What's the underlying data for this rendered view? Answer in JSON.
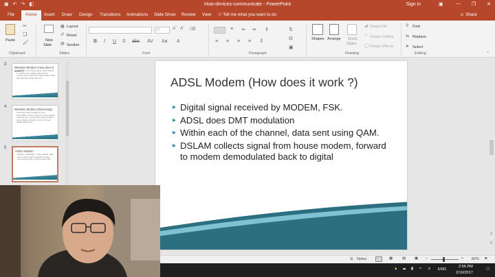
{
  "window": {
    "title": "How-devices-communicate - PowerPoint",
    "sign_in": "Sign in",
    "quick_access": [
      "save-icon",
      "undo-icon",
      "redo-icon",
      "present-icon"
    ]
  },
  "tabs": [
    "File",
    "Home",
    "Insert",
    "Draw",
    "Design",
    "Transitions",
    "Animations",
    "Slide Show",
    "Review",
    "View"
  ],
  "active_tab": "Home",
  "tell_me": "Tell me what you want to do",
  "share_label": "Share",
  "ribbon": {
    "clipboard": {
      "paste": "Paste",
      "label": "Clipboard"
    },
    "slides": {
      "new_slide_1": "New",
      "new_slide_2": "Slide",
      "layout": "Layout",
      "reset": "Reset",
      "section": "Section",
      "label": "Slides"
    },
    "font": {
      "size": "27",
      "label": "Font"
    },
    "paragraph": {
      "label": "Paragraph"
    },
    "drawing": {
      "shapes": "Shapes",
      "arrange": "Arrange",
      "quick_styles_1": "Quick",
      "quick_styles_2": "Styles",
      "shape_fill": "Shape Fill",
      "shape_outline": "Shape Outline",
      "shape_effects": "Shape Effects",
      "label": "Drawing"
    },
    "editing": {
      "find": "Find",
      "replace": "Replace",
      "select": "Select",
      "label": "Editing"
    }
  },
  "thumbnails": [
    {
      "num": "3",
      "title": "Wireless Modem (How does it work?)",
      "body": "Will detect incoming signal, demodulate it, convert it to usable data for PC; modem then transmits signal back as RF; has antenna inside the box"
    },
    {
      "num": "4",
      "title": "Wireless Modem (Receiving)",
      "body": "Received radio frequency from transmitter, down-convert to intermediate frequency by mixing with local oscillator; demodulate using the same IF; pass digital data to PC"
    },
    {
      "num": "5",
      "title": "ADSL Modem",
      "body": "Modem - Modulate - Demodulate; DSL uses copper wire of telephone line; Asymmetric DSL vs Symmetric DSL"
    }
  ],
  "slide": {
    "title": "ADSL Modem (How does it work ?)",
    "bullets": [
      "Digital signal received by MODEM, FSK.",
      "ADSL does DMT modulation",
      "Within each of the channel, data sent using QAM.",
      "DSLAM collects signal from house modem, forward to modem demodulated back to digital"
    ]
  },
  "status": {
    "notes": "Notes",
    "zoom": "82%"
  },
  "taskbar": {
    "lang": "ENG",
    "time": "2:56 PM",
    "date": "2/10/2017"
  },
  "colors": {
    "accent": "#b7472a",
    "bullet": "#2b8fa8",
    "slide_band": "#2b6f80"
  }
}
